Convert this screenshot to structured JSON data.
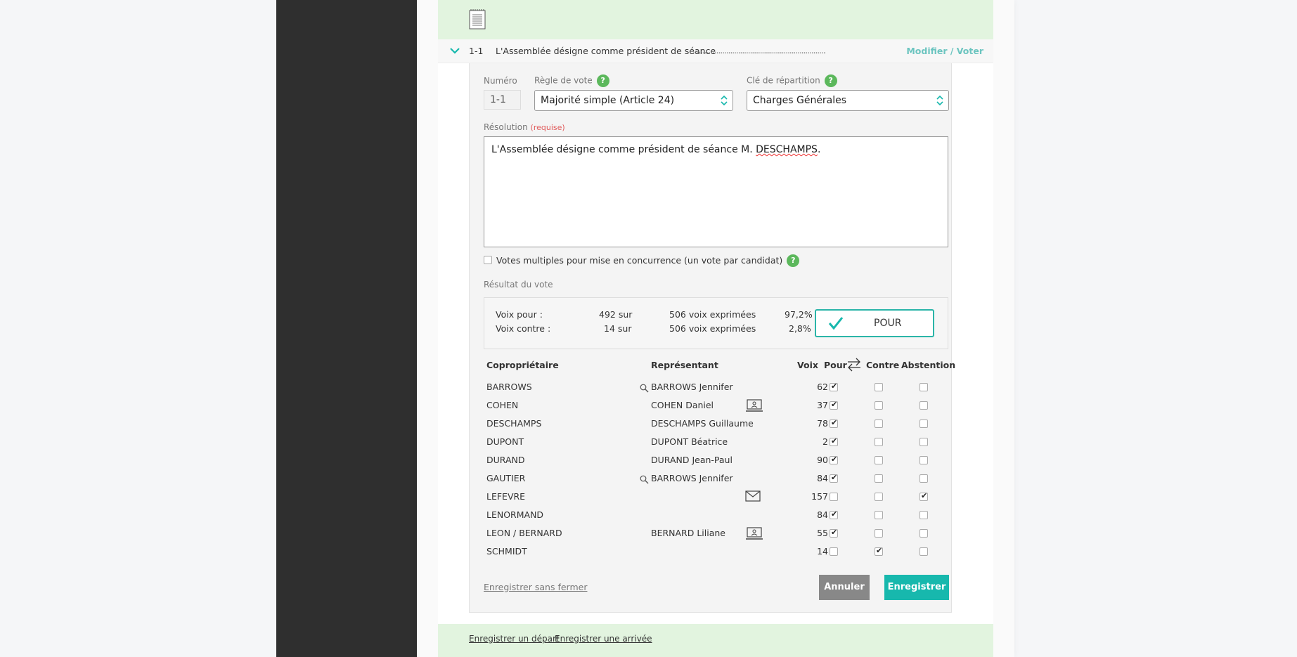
{
  "item": {
    "number": "1-1",
    "title": "L'Assemblée désigne comme président de séance",
    "dots": "..............................................................................",
    "action_link": "Modifier / Voter"
  },
  "form": {
    "numero_label": "Numéro",
    "numero_value": "1-1",
    "regle_label": "Règle de vote",
    "regle_value": "Majorité simple (Article 24)",
    "cle_label": "Clé de répartition",
    "cle_value": "Charges Générales",
    "help_glyph": "?",
    "resolution_label": "Résolution",
    "resolution_required": "(requise)",
    "resolution_text_before": "L'Assemblée désigne comme président de séance M. ",
    "resolution_text_flagged": "DESCHAMPS",
    "resolution_text_after": ".",
    "multi_label": "Votes multiples pour mise en concurrence (un vote par candidat)",
    "result_label": "Résultat du vote"
  },
  "result": {
    "pour_label": "Voix pour :",
    "pour_count": "492 sur",
    "pour_total": "506 voix exprimées",
    "pour_pct": "97,2%",
    "contre_label": "Voix contre :",
    "contre_count": "14 sur",
    "contre_total": "506 voix exprimées",
    "contre_pct": "2,8%",
    "decision": "POUR"
  },
  "table": {
    "headers": {
      "coproprietaire": "Copropriétaire",
      "representant": "Représentant",
      "voix": "Voix",
      "pour": "Pour",
      "contre": "Contre",
      "abstention": "Abstention"
    },
    "rows": [
      {
        "owner": "BARROWS",
        "rep": "BARROWS Jennifer",
        "icon": "search",
        "voix": "62",
        "vote": "pour"
      },
      {
        "owner": "COHEN",
        "rep": "COHEN Daniel",
        "icon": "laptop",
        "voix": "37",
        "vote": "pour"
      },
      {
        "owner": "DESCHAMPS",
        "rep": "DESCHAMPS Guillaume",
        "icon": "",
        "voix": "78",
        "vote": "pour"
      },
      {
        "owner": "DUPONT",
        "rep": "DUPONT Béatrice",
        "icon": "",
        "voix": "2",
        "vote": "pour"
      },
      {
        "owner": "DURAND",
        "rep": "DURAND Jean-Paul",
        "icon": "",
        "voix": "90",
        "vote": "pour"
      },
      {
        "owner": "GAUTIER",
        "rep": "BARROWS Jennifer",
        "icon": "search",
        "voix": "84",
        "vote": "pour"
      },
      {
        "owner": "LEFEVRE",
        "rep": "",
        "icon": "mail",
        "voix": "157",
        "vote": "abstention"
      },
      {
        "owner": "LENORMAND",
        "rep": "",
        "icon": "",
        "voix": "84",
        "vote": "pour"
      },
      {
        "owner": "LEON / BERNARD",
        "rep": "BERNARD Liliane",
        "icon": "laptop",
        "voix": "55",
        "vote": "pour"
      },
      {
        "owner": "SCHMIDT",
        "rep": "",
        "icon": "",
        "voix": "14",
        "vote": "contre"
      }
    ]
  },
  "actions": {
    "save_no_close": "Enregistrer sans fermer",
    "cancel": "Annuler",
    "save": "Enregistrer"
  },
  "bottom": {
    "depart": "Enregistrer un départ",
    "arrivee": "Enregistrer une arrivée"
  }
}
